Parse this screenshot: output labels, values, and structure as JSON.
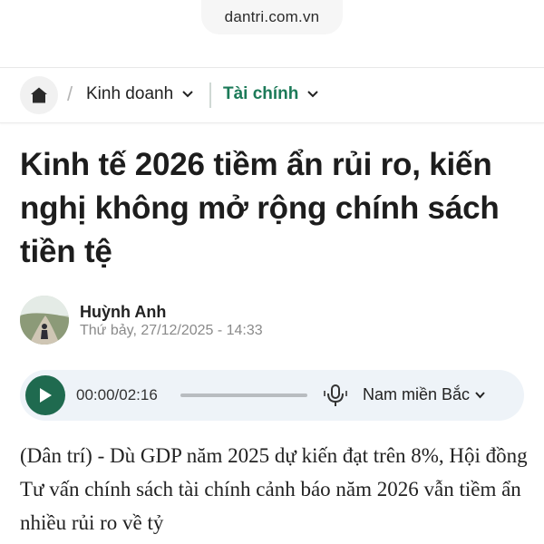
{
  "browser": {
    "url": "dantri.com.vn"
  },
  "breadcrumb": {
    "home_icon": "home-icon",
    "separator": "/",
    "category": "Kinh doanh",
    "subcategory": "Tài chính",
    "subcategory_color": "#1c7a58"
  },
  "article": {
    "title": "Kinh tế 2026 tiềm ẩn rủi ro, kiến nghị không mở rộng chính sách tiền tệ",
    "author": "Huỳnh Anh",
    "published": "Thứ bảy, 27/12/2025 - 14:33",
    "body": "(Dân trí) - Dù GDP năm 2025 dự kiến đạt trên 8%, Hội đồng Tư vấn chính sách tài chính cảnh báo năm 2026 vẫn tiềm ẩn nhiều rủi ro về tỷ"
  },
  "audio_player": {
    "time": "00:00/02:16",
    "progress": 0,
    "voice": "Nam miền Bắc",
    "play_color": "#1f6a4f",
    "background": "#eef3f8"
  }
}
